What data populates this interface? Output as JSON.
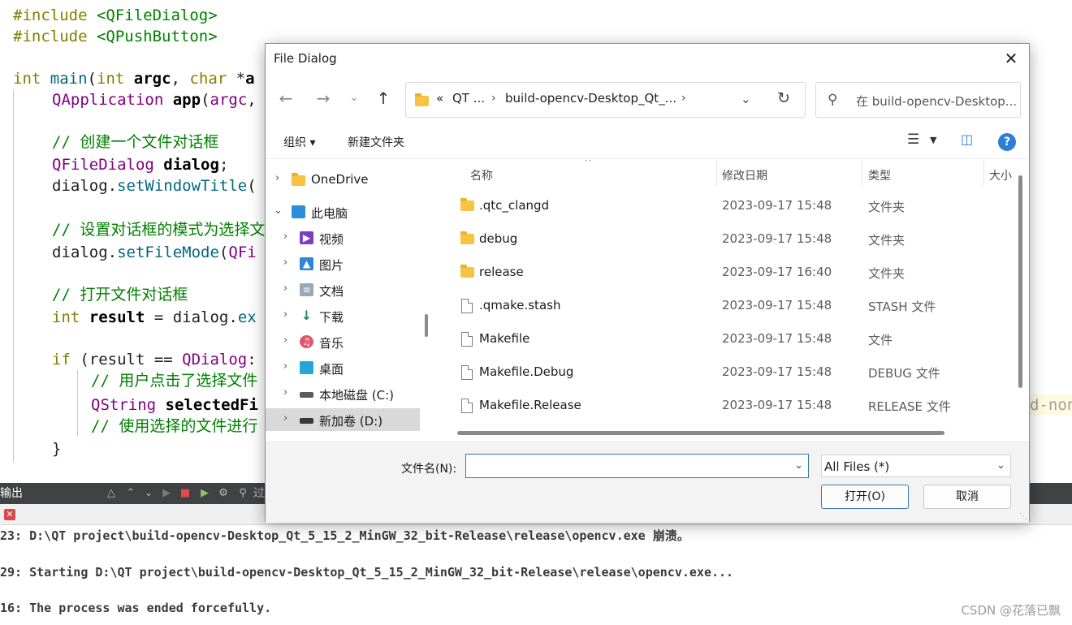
{
  "editor": {
    "lines": [
      "#include <QFileDialog>",
      "#include <QPushButton>",
      "int main(int argc, char *a",
      "    QApplication app(argc,",
      "    // 创建一个文件对话框",
      "    QFileDialog dialog;",
      "    dialog.setWindowTitle(",
      "    // 设置对话框的模式为选择文",
      "    dialog.setFileMode(QFi",
      "    // 打开文件对话框",
      "    int result = dialog.ex",
      "    if (result == QDialog:",
      "        // 用户点击了选择文件",
      "        QString selectedFi",
      "        // 使用选择的文件进行",
      "    }"
    ],
    "right_peek": "d-non"
  },
  "output": {
    "toolbar_label": "输出",
    "filter_placeholder": "过",
    "lines": [
      "23: D:\\QT project\\build-opencv-Desktop_Qt_5_15_2_MinGW_32_bit-Release\\release\\opencv.exe 崩溃。",
      "29: Starting D:\\QT project\\build-opencv-Desktop_Qt_5_15_2_MinGW_32_bit-Release\\release\\opencv.exe...",
      "16: The process was ended forcefully."
    ],
    "watermark": "CSDN @花落已飘"
  },
  "dialog": {
    "title": "File Dialog",
    "address": {
      "prefix": "«",
      "crumbs": [
        "QT ...",
        "build-opencv-Desktop_Qt_..."
      ]
    },
    "search_placeholder": "在 build-opencv-Desktop...",
    "commands": {
      "organize": "组织",
      "new_folder": "新建文件夹"
    },
    "nav_items": [
      {
        "label": "OneDrive",
        "icon": "folder-icon"
      },
      {
        "label": "此电脑",
        "icon": "computer-icon"
      },
      {
        "label": "视频",
        "icon": "video-icon"
      },
      {
        "label": "图片",
        "icon": "pictures-icon"
      },
      {
        "label": "文档",
        "icon": "documents-icon"
      },
      {
        "label": "下载",
        "icon": "download-icon"
      },
      {
        "label": "音乐",
        "icon": "music-icon"
      },
      {
        "label": "桌面",
        "icon": "desktop-icon"
      },
      {
        "label": "本地磁盘 (C:)",
        "icon": "drive-icon"
      },
      {
        "label": "新加卷 (D:)",
        "icon": "drive-icon"
      }
    ],
    "columns": {
      "name": "名称",
      "date": "修改日期",
      "type": "类型",
      "size": "大小"
    },
    "files": [
      {
        "name": ".qtc_clangd",
        "date": "2023-09-17 15:48",
        "type": "文件夹",
        "kind": "folder"
      },
      {
        "name": "debug",
        "date": "2023-09-17 15:48",
        "type": "文件夹",
        "kind": "folder"
      },
      {
        "name": "release",
        "date": "2023-09-17 16:40",
        "type": "文件夹",
        "kind": "folder"
      },
      {
        "name": ".qmake.stash",
        "date": "2023-09-17 15:48",
        "type": "STASH 文件",
        "kind": "file"
      },
      {
        "name": "Makefile",
        "date": "2023-09-17 15:48",
        "type": "文件",
        "kind": "file"
      },
      {
        "name": "Makefile.Debug",
        "date": "2023-09-17 15:48",
        "type": "DEBUG 文件",
        "kind": "file"
      },
      {
        "name": "Makefile.Release",
        "date": "2023-09-17 15:48",
        "type": "RELEASE 文件",
        "kind": "file"
      }
    ],
    "filename_label": "文件名(N):",
    "filename_value": "",
    "filter_value": "All Files (*)",
    "open_button": "打开(O)",
    "cancel_button": "取消"
  }
}
